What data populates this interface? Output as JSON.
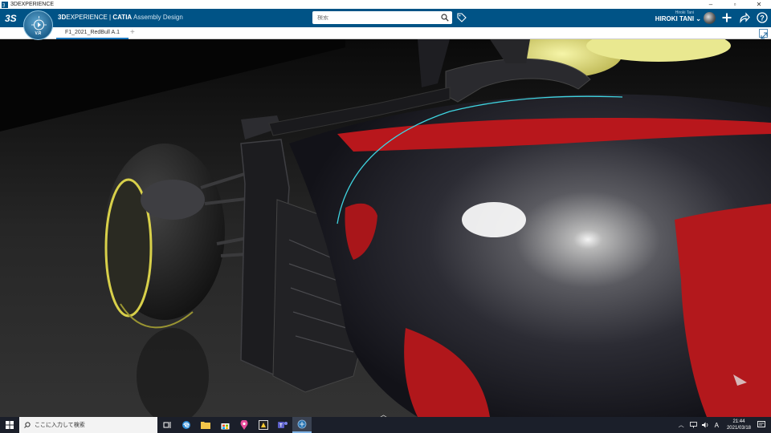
{
  "window": {
    "title": "3DEXPERIENCE"
  },
  "topbar": {
    "brand_part1": "3D",
    "brand_part2": "EXPERIENCE",
    "brand_sep": " | ",
    "brand_app": "CATIA",
    "brand_module": " Assembly Design",
    "search_placeholder": "検索",
    "user_small": "Hiroki Tani",
    "user_name": "HIROKI TANI"
  },
  "compass": {
    "version": "V.R"
  },
  "tabs": {
    "active": "F1_2021_RedBull A.1",
    "add_label": "+"
  },
  "viewport": {
    "collapse": "︿"
  },
  "taskbar": {
    "search_placeholder": "ここに入力して検索",
    "time": "21:44",
    "date": "2021/03/18",
    "ime": "A"
  },
  "colors": {
    "topbar": "#005386",
    "accent": "#1c78c0",
    "livery_red": "#c4181d"
  }
}
